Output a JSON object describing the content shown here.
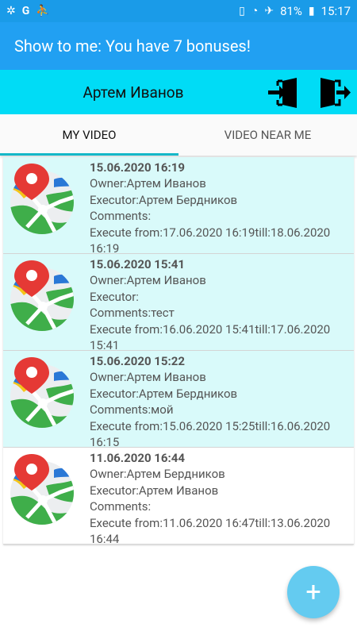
{
  "status_bar": {
    "battery": "81%",
    "time": "15:17",
    "left_icons": [
      "settings-icon",
      "google-icon",
      "walking-icon"
    ],
    "right_icons": [
      "vibrate-icon",
      "wifi-icon",
      "airplane-icon",
      "battery-icon"
    ]
  },
  "app_bar": {
    "title": "Show to me: You have 7 bonuses!"
  },
  "user_bar": {
    "name": "Артем Иванов",
    "icons": [
      "login-icon",
      "logout-icon"
    ]
  },
  "tabs": [
    {
      "label": "MY VIDEO",
      "active": true
    },
    {
      "label": "VIDEO NEAR ME",
      "active": false
    }
  ],
  "items": [
    {
      "date": "15.06.2020 16:19",
      "owner": "Owner:Артем Иванов",
      "executor": "Executor:Артем Бердников",
      "comments": "Comments:",
      "execute1": "Execute from:17.06.2020 16:19till:18.06.2020",
      "execute2": "16:19",
      "highlight": true
    },
    {
      "date": "15.06.2020 15:41",
      "owner": "Owner:Артем Иванов",
      "executor": "Executor:",
      "comments": "Comments:тест",
      "execute1": "Execute from:16.06.2020 15:41till:17.06.2020",
      "execute2": "15:41",
      "highlight": true
    },
    {
      "date": "15.06.2020 15:22",
      "owner": "Owner:Артем Иванов",
      "executor": "Executor:Артем Бердников",
      "comments": "Comments:мой",
      "execute1": "Execute from:15.06.2020 15:25till:16.06.2020",
      "execute2": "16:15",
      "highlight": true
    },
    {
      "date": "11.06.2020 16:44",
      "owner": "Owner:Артем Бердников",
      "executor": "Executor:Артем Иванов",
      "comments": "Comments:",
      "execute1": "Execute from:11.06.2020 16:47till:13.06.2020",
      "execute2": "16:44",
      "highlight": false
    }
  ],
  "fab": {
    "label": "+"
  },
  "colors": {
    "status_bar": "#1a9be8",
    "app_bar": "#21a0f2",
    "user_bar": "#00dcf6",
    "tab_indicator": "#14b8c8",
    "item_highlight": "#d9fafa",
    "fab": "#64cbf0"
  }
}
